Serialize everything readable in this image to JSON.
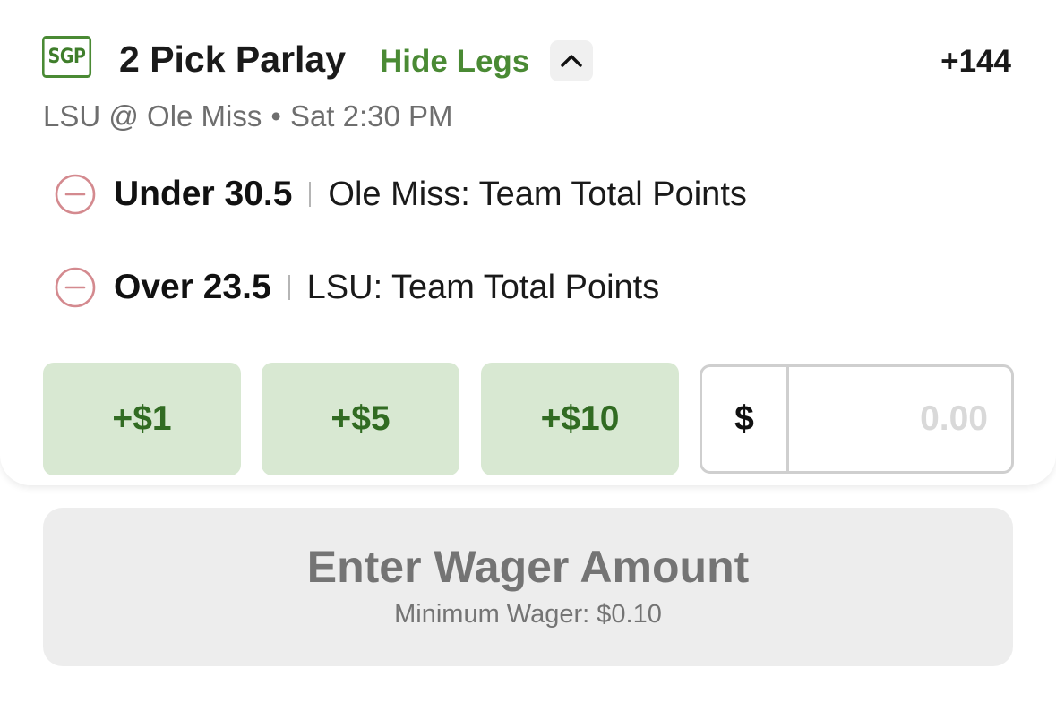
{
  "bet": {
    "badge": "SGP",
    "title": "2 Pick Parlay",
    "toggle_label": "Hide Legs",
    "odds": "+144",
    "game": {
      "matchup": "LSU @ Ole Miss",
      "separator": "•",
      "time": "Sat 2:30 PM"
    },
    "legs": [
      {
        "line": "Under 30.5",
        "market": "Ole Miss: Team Total Points"
      },
      {
        "line": "Over 23.5",
        "market": "LSU: Team Total Points"
      }
    ]
  },
  "wager": {
    "quick_amounts": [
      "+$1",
      "+$5",
      "+$10"
    ],
    "currency_symbol": "$",
    "amount_value": "",
    "amount_placeholder": "0.00"
  },
  "submit": {
    "label": "Enter Wager Amount",
    "sublabel": "Minimum Wager: $0.10"
  },
  "icons": {
    "toggle": "chevron-up-icon",
    "remove_leg": "minus-circle-icon"
  },
  "colors": {
    "brand_green": "#4a8a34",
    "quick_button_bg": "#d8e8d2",
    "quick_button_text": "#316b22",
    "remove_icon": "#d48a8f",
    "disabled_button_bg": "#ededed",
    "disabled_button_text": "#747474"
  }
}
